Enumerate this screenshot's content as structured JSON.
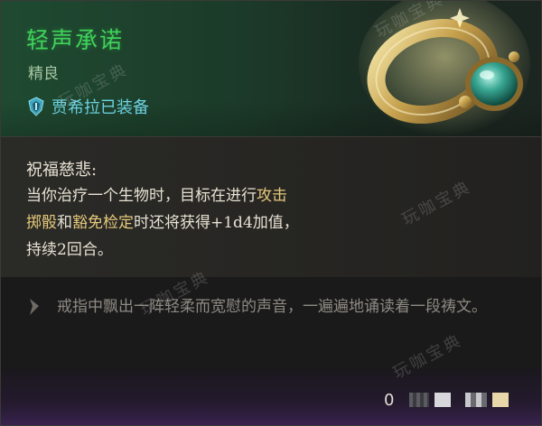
{
  "item": {
    "name": "轻声承诺",
    "rarity": "精良",
    "equipped_by": "贾希拉已装备",
    "colors": {
      "name": "#3fd35a",
      "equipped": "#6fd8e8",
      "keyword": "#e5c97b"
    },
    "icons": {
      "equipped": "shield-crest-icon",
      "art": "ring-artwork",
      "flavor": "quill-icon"
    }
  },
  "description": {
    "title": "祝福慈悲:",
    "line1_pre": "当你治疗一个生物时，目标在进行",
    "line1_kw": "攻击",
    "line2_kw1": "掷骰",
    "line2_mid": "和",
    "line2_kw2": "豁免检定",
    "line2_post": "时还将获得+1d4加值，",
    "line3": "持续2回合。"
  },
  "flavor": {
    "text": "戒指中飘出一阵轻柔而宽慰的声音，一遍遍地诵读着一段祷文。"
  },
  "footer": {
    "value": "0"
  },
  "watermark": {
    "text": "玩咖宝典"
  }
}
